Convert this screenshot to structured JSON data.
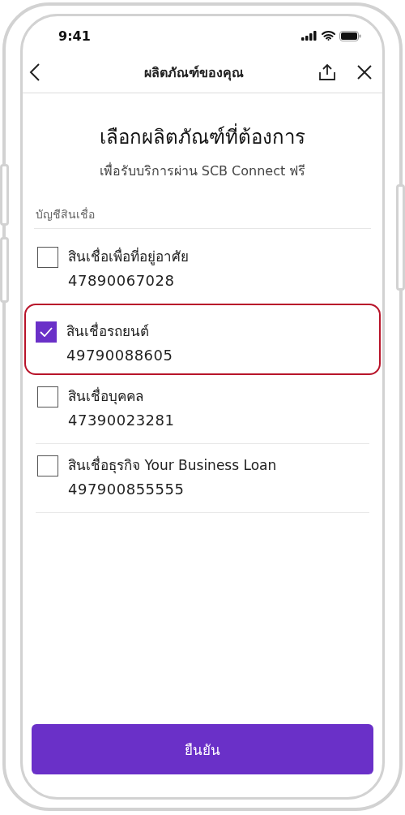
{
  "status_bar": {
    "time": "9:41"
  },
  "nav": {
    "title": "ผลิตภัณฑ์ของคุณ"
  },
  "heading": "เลือกผลิตภัณฑ์ที่ต้องการ",
  "subheading": "เพื่อรับบริการผ่าน SCB Connect ฟรี",
  "section_label": "บัญชีสินเชื่อ",
  "accounts": [
    {
      "name": "สินเชื่อเพื่อที่อยู่อาศัย",
      "number": "47890067028",
      "checked": false
    },
    {
      "name": "สินเชื่อรถยนต์",
      "number": "49790088605",
      "checked": true
    },
    {
      "name": "สินเชื่อบุคคล",
      "number": "47390023281",
      "checked": false
    },
    {
      "name": "สินเชื่อธุรกิจ Your Business Loan",
      "number": "497900855555",
      "checked": false
    }
  ],
  "confirm_button": "ยืนยัน"
}
